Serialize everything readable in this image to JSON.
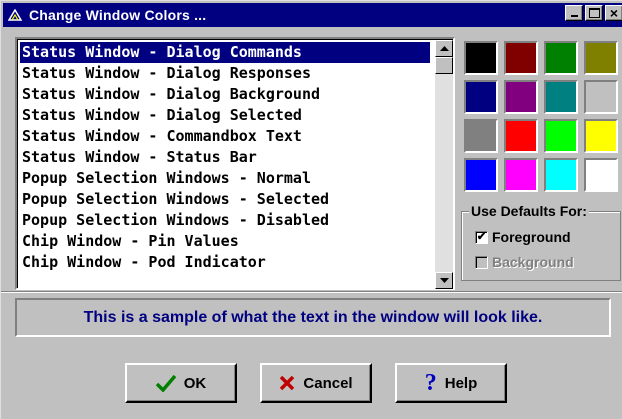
{
  "window": {
    "title": "Change Window Colors ...",
    "controls": {
      "minimize": "_",
      "maximize": "□",
      "close": "×"
    }
  },
  "list": {
    "items": [
      "Status Window - Dialog Commands",
      "Status Window - Dialog Responses",
      "Status Window - Dialog Background",
      "Status Window - Dialog Selected",
      "Status Window - Commandbox Text",
      "Status Window - Status Bar",
      "Popup Selection Windows - Normal",
      "Popup Selection Windows - Selected",
      "Popup Selection Windows - Disabled",
      "Chip Window - Pin Values",
      "Chip Window - Pod Indicator"
    ],
    "selected_index": 0
  },
  "palette": {
    "colors": [
      "#000000",
      "#800000",
      "#008000",
      "#808000",
      "#000080",
      "#800080",
      "#008080",
      "#c0c0c0",
      "#808080",
      "#ff0000",
      "#00ff00",
      "#ffff00",
      "#0000ff",
      "#ff00ff",
      "#00ffff",
      "#ffffff"
    ]
  },
  "defaults": {
    "label": "Use Defaults For:",
    "foreground": {
      "label": "Foreground",
      "checked": true,
      "enabled": true
    },
    "background": {
      "label": "Background",
      "checked": false,
      "enabled": false
    }
  },
  "sample_text": "This is a sample of what the text in the window will look like.",
  "buttons": {
    "ok": {
      "label": "OK",
      "icon": "checkmark-icon",
      "color": "#008000"
    },
    "cancel": {
      "label": "Cancel",
      "icon": "x-icon",
      "color": "#c00000"
    },
    "help": {
      "label": "Help",
      "icon": "question-icon",
      "color": "#0000c0"
    }
  }
}
